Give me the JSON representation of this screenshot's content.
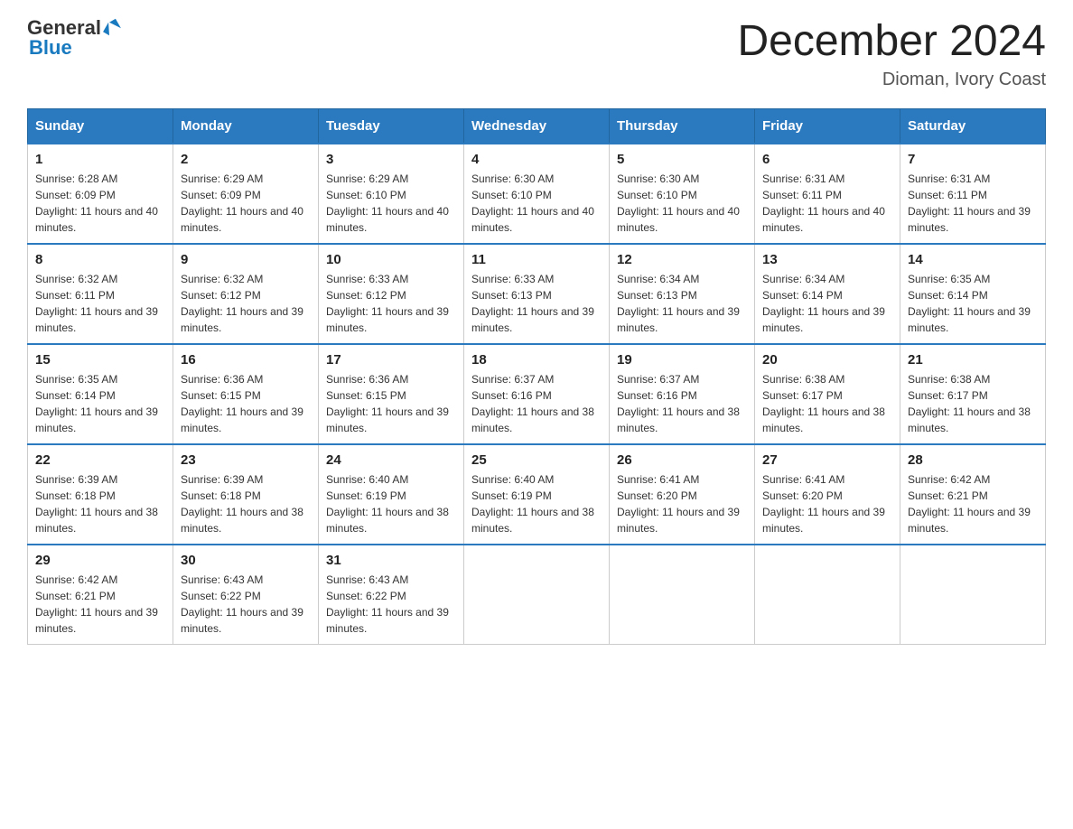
{
  "logo": {
    "text_general": "General",
    "text_blue": "Blue"
  },
  "header": {
    "month_title": "December 2024",
    "location": "Dioman, Ivory Coast"
  },
  "weekdays": [
    "Sunday",
    "Monday",
    "Tuesday",
    "Wednesday",
    "Thursday",
    "Friday",
    "Saturday"
  ],
  "weeks": [
    [
      {
        "day": "1",
        "sunrise": "6:28 AM",
        "sunset": "6:09 PM",
        "daylight": "11 hours and 40 minutes."
      },
      {
        "day": "2",
        "sunrise": "6:29 AM",
        "sunset": "6:09 PM",
        "daylight": "11 hours and 40 minutes."
      },
      {
        "day": "3",
        "sunrise": "6:29 AM",
        "sunset": "6:10 PM",
        "daylight": "11 hours and 40 minutes."
      },
      {
        "day": "4",
        "sunrise": "6:30 AM",
        "sunset": "6:10 PM",
        "daylight": "11 hours and 40 minutes."
      },
      {
        "day": "5",
        "sunrise": "6:30 AM",
        "sunset": "6:10 PM",
        "daylight": "11 hours and 40 minutes."
      },
      {
        "day": "6",
        "sunrise": "6:31 AM",
        "sunset": "6:11 PM",
        "daylight": "11 hours and 40 minutes."
      },
      {
        "day": "7",
        "sunrise": "6:31 AM",
        "sunset": "6:11 PM",
        "daylight": "11 hours and 39 minutes."
      }
    ],
    [
      {
        "day": "8",
        "sunrise": "6:32 AM",
        "sunset": "6:11 PM",
        "daylight": "11 hours and 39 minutes."
      },
      {
        "day": "9",
        "sunrise": "6:32 AM",
        "sunset": "6:12 PM",
        "daylight": "11 hours and 39 minutes."
      },
      {
        "day": "10",
        "sunrise": "6:33 AM",
        "sunset": "6:12 PM",
        "daylight": "11 hours and 39 minutes."
      },
      {
        "day": "11",
        "sunrise": "6:33 AM",
        "sunset": "6:13 PM",
        "daylight": "11 hours and 39 minutes."
      },
      {
        "day": "12",
        "sunrise": "6:34 AM",
        "sunset": "6:13 PM",
        "daylight": "11 hours and 39 minutes."
      },
      {
        "day": "13",
        "sunrise": "6:34 AM",
        "sunset": "6:14 PM",
        "daylight": "11 hours and 39 minutes."
      },
      {
        "day": "14",
        "sunrise": "6:35 AM",
        "sunset": "6:14 PM",
        "daylight": "11 hours and 39 minutes."
      }
    ],
    [
      {
        "day": "15",
        "sunrise": "6:35 AM",
        "sunset": "6:14 PM",
        "daylight": "11 hours and 39 minutes."
      },
      {
        "day": "16",
        "sunrise": "6:36 AM",
        "sunset": "6:15 PM",
        "daylight": "11 hours and 39 minutes."
      },
      {
        "day": "17",
        "sunrise": "6:36 AM",
        "sunset": "6:15 PM",
        "daylight": "11 hours and 39 minutes."
      },
      {
        "day": "18",
        "sunrise": "6:37 AM",
        "sunset": "6:16 PM",
        "daylight": "11 hours and 38 minutes."
      },
      {
        "day": "19",
        "sunrise": "6:37 AM",
        "sunset": "6:16 PM",
        "daylight": "11 hours and 38 minutes."
      },
      {
        "day": "20",
        "sunrise": "6:38 AM",
        "sunset": "6:17 PM",
        "daylight": "11 hours and 38 minutes."
      },
      {
        "day": "21",
        "sunrise": "6:38 AM",
        "sunset": "6:17 PM",
        "daylight": "11 hours and 38 minutes."
      }
    ],
    [
      {
        "day": "22",
        "sunrise": "6:39 AM",
        "sunset": "6:18 PM",
        "daylight": "11 hours and 38 minutes."
      },
      {
        "day": "23",
        "sunrise": "6:39 AM",
        "sunset": "6:18 PM",
        "daylight": "11 hours and 38 minutes."
      },
      {
        "day": "24",
        "sunrise": "6:40 AM",
        "sunset": "6:19 PM",
        "daylight": "11 hours and 38 minutes."
      },
      {
        "day": "25",
        "sunrise": "6:40 AM",
        "sunset": "6:19 PM",
        "daylight": "11 hours and 38 minutes."
      },
      {
        "day": "26",
        "sunrise": "6:41 AM",
        "sunset": "6:20 PM",
        "daylight": "11 hours and 39 minutes."
      },
      {
        "day": "27",
        "sunrise": "6:41 AM",
        "sunset": "6:20 PM",
        "daylight": "11 hours and 39 minutes."
      },
      {
        "day": "28",
        "sunrise": "6:42 AM",
        "sunset": "6:21 PM",
        "daylight": "11 hours and 39 minutes."
      }
    ],
    [
      {
        "day": "29",
        "sunrise": "6:42 AM",
        "sunset": "6:21 PM",
        "daylight": "11 hours and 39 minutes."
      },
      {
        "day": "30",
        "sunrise": "6:43 AM",
        "sunset": "6:22 PM",
        "daylight": "11 hours and 39 minutes."
      },
      {
        "day": "31",
        "sunrise": "6:43 AM",
        "sunset": "6:22 PM",
        "daylight": "11 hours and 39 minutes."
      },
      null,
      null,
      null,
      null
    ]
  ]
}
